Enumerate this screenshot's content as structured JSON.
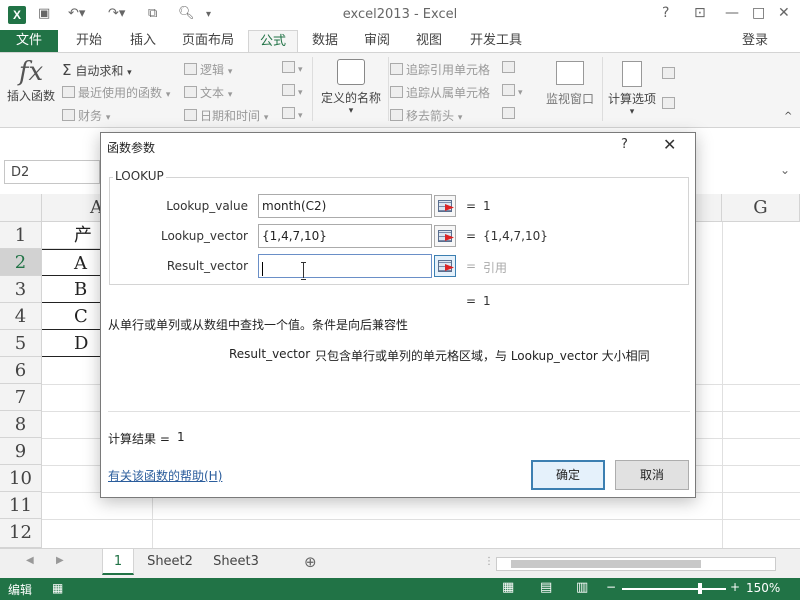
{
  "app": {
    "window_title": "excel2013 - Excel",
    "login": "登录",
    "logo": "X"
  },
  "tabs": [
    "文件",
    "开始",
    "插入",
    "页面布局",
    "公式",
    "数据",
    "审阅",
    "视图",
    "开发工具"
  ],
  "ribbon": {
    "insert_function": "插入函数",
    "autosum": "自动求和",
    "recent": "最近使用的函数",
    "finance": "财务",
    "logic": "逻辑",
    "text": "文本",
    "datetime": "日期和时间",
    "defined_names": "定义的名称",
    "trace_precedents": "追踪引用单元格",
    "trace_dependents": "追踪从属单元格",
    "remove_arrows": "移去箭头",
    "watch_window": "监视窗口",
    "calc_options": "计算选项"
  },
  "formula_bar": {
    "name_box": "D2"
  },
  "grid": {
    "columns": [
      "A",
      "G"
    ],
    "rows": [
      "1",
      "2",
      "3",
      "4",
      "5",
      "6",
      "7",
      "8",
      "9",
      "10",
      "11",
      "12"
    ],
    "cells": [
      {
        "row": "1",
        "text": "产"
      },
      {
        "row": "2",
        "text": "A"
      },
      {
        "row": "3",
        "text": "B"
      },
      {
        "row": "4",
        "text": "C"
      },
      {
        "row": "5",
        "text": "D"
      }
    ]
  },
  "sheets": {
    "tabs": [
      "1",
      "Sheet2",
      "Sheet3"
    ],
    "add": "⊕"
  },
  "status": {
    "mode": "编辑",
    "zoom": "150%"
  },
  "dialog": {
    "title": "函数参数",
    "help": "?",
    "close": "✕",
    "function_name": "LOOKUP",
    "args": [
      {
        "label": "Lookup_value",
        "value": "month(C2)",
        "result": "1"
      },
      {
        "label": "Lookup_vector",
        "value": "{1,4,7,10}",
        "result": "{1,4,7,10}"
      },
      {
        "label": "Result_vector",
        "value": "",
        "result": "引用"
      }
    ],
    "overall_result": "1",
    "description": "从单行或单列或从数组中查找一个值。条件是向后兼容性",
    "arg_desc_name": "Result_vector",
    "arg_desc_text": "只包含单行或单列的单元格区域，与 Lookup_vector 大小相同",
    "calc_result_label": "计算结果 =",
    "calc_result_value": "1",
    "help_link": "有关该函数的帮助(H)",
    "ok": "确定",
    "cancel": "取消"
  },
  "colors": {
    "excel_green": "#217346",
    "dialog_focus_blue": "#3c7fb1"
  }
}
